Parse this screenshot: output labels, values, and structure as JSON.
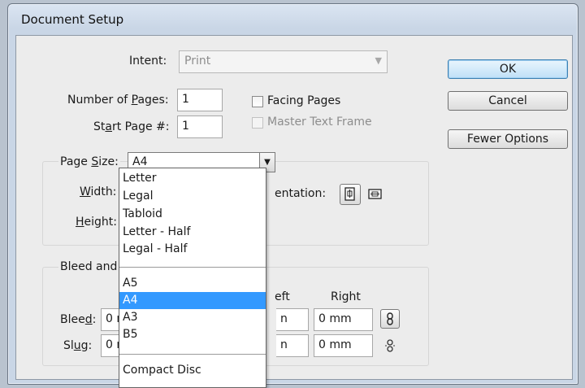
{
  "window": {
    "title": "Document Setup"
  },
  "intent": {
    "label": "Intent:",
    "value": "Print"
  },
  "pages": {
    "number_label_pre": "Number of ",
    "number_label_u": "P",
    "number_label_post": "ages:",
    "number_value": "1",
    "start_label_pre": "St",
    "start_label_u": "a",
    "start_label_post": "rt Page #:",
    "start_value": "1",
    "facing_pages": "Facing Pages",
    "master_text_frame": "Master Text Frame"
  },
  "page_size": {
    "group_label_pre": "Page ",
    "group_label_u": "S",
    "group_label_post": "ize:",
    "value": "A4",
    "width_label_u": "W",
    "width_label_post": "idth:",
    "height_label_u": "H",
    "height_label_post": "eight:",
    "orientation_label": "entation:"
  },
  "bleed_slug": {
    "group_label": "Bleed and S",
    "col_left_partial": "eft",
    "col_right": "Right",
    "bleed_label_pre": "Blee",
    "bleed_label_u": "d",
    "bleed_label_post": ":",
    "slug_label_pre": "Sl",
    "slug_label_u": "u",
    "slug_label_post": "g:",
    "bleed_left_partial": "0 m",
    "bleed_left2_partial": "n",
    "bleed_right": "0 mm",
    "slug_left_partial": "0 m",
    "slug_left2_partial": "n",
    "slug_right": "0 mm"
  },
  "buttons": {
    "ok": "OK",
    "cancel": "Cancel",
    "fewer_options": "Fewer Options"
  },
  "dropdown": {
    "options_group1": [
      "Letter",
      "Legal",
      "Tabloid",
      "Letter - Half",
      "Legal - Half"
    ],
    "options_group2": [
      "A5",
      "A4",
      "A3",
      "B5"
    ],
    "options_group3": [
      "Compact Disc"
    ],
    "selected": "A4"
  },
  "colors": {
    "selection": "#3399ff",
    "default_button_border": "#3c7fb1"
  }
}
